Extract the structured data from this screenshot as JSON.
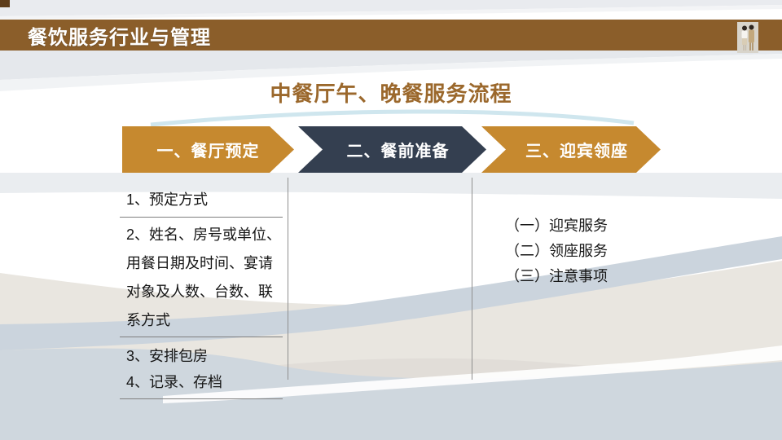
{
  "header": {
    "title": "餐饮服务行业与管理"
  },
  "images": {
    "staff_photo": "two-restaurant-staff-in-uniform"
  },
  "content": {
    "title": "中餐厅午、晚餐服务流程",
    "steps": [
      {
        "label": "一、餐厅预定",
        "color": "#C6892F"
      },
      {
        "label": "二、餐前准备",
        "color": "#343F50"
      },
      {
        "label": "三、迎宾领座",
        "color": "#C6892F"
      }
    ],
    "left_column": {
      "items": [
        "1、预定方式",
        "2、姓名、房号或单位、用餐日期及时间、宴请对象及人数、台数、联系方式",
        "3、安排包房",
        "4、记录、存档"
      ]
    },
    "right_column": {
      "items": [
        "（一）迎宾服务",
        "（二）领座服务",
        "（三）注意事项"
      ]
    }
  },
  "colors": {
    "header_bar": "#8B5E2A",
    "accent_gold": "#C6892F",
    "accent_navy": "#343F50",
    "title_text": "#9B682C",
    "body_text": "#161616",
    "divider": "#8F8F8F",
    "wave_blue_gray": "#CBD4DD",
    "wave_beige": "#E9E6E0",
    "bottom_band": "#CFD7DE",
    "teal_swoosh": "#CFE6EE"
  }
}
